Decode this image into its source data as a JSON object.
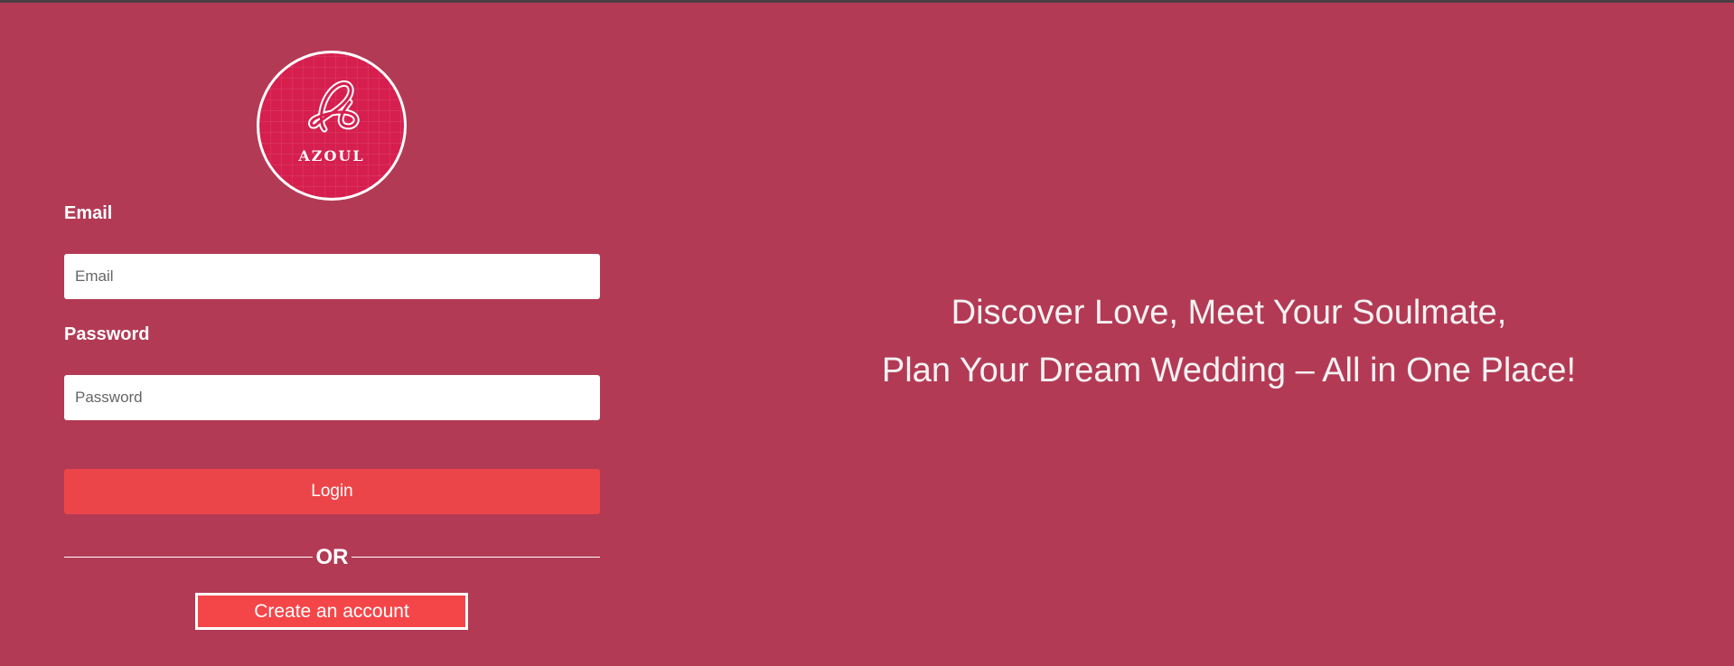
{
  "brand": {
    "logo_text": "AZOUL",
    "background_color": "#b33a55",
    "logo_color": "#d61f4f",
    "accent_color": "#ec4549"
  },
  "login_form": {
    "email_label": "Email",
    "email_placeholder": "Email",
    "password_label": "Password",
    "password_placeholder": "Password",
    "login_button": "Login",
    "divider_text": "OR",
    "create_account_button": "Create an account"
  },
  "hero": {
    "line1": "Discover Love, Meet Your Soulmate,",
    "line2": "Plan Your Dream Wedding – All in One Place!"
  }
}
